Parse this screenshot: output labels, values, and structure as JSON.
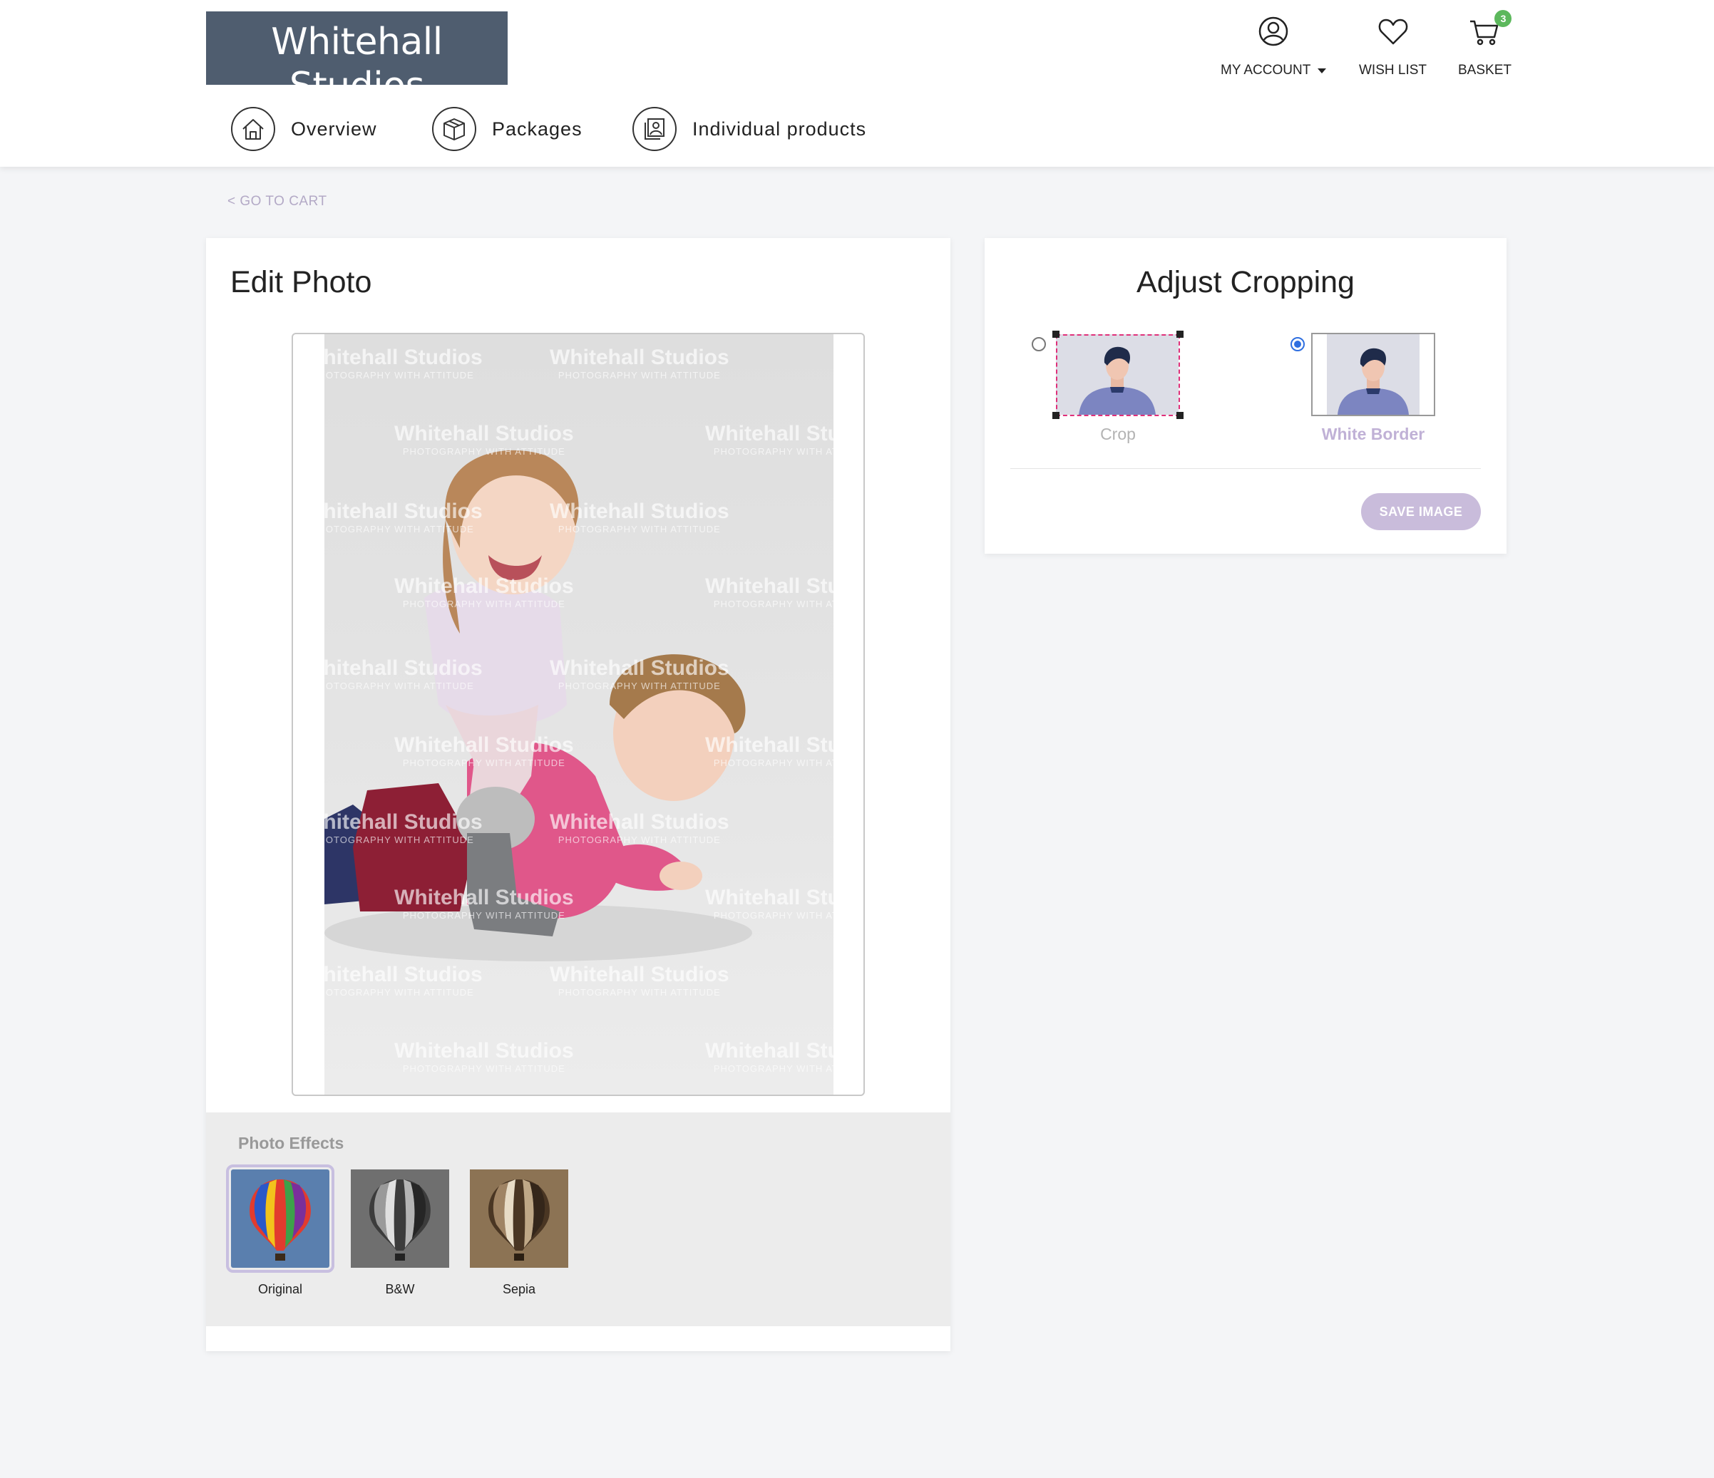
{
  "brand": {
    "name": "Whitehall Studios",
    "tagline": "PHOTOGRAPHY WITH ATTITUDE"
  },
  "header_nav": {
    "account": "MY ACCOUNT",
    "wishlist": "WISH LIST",
    "basket": "BASKET",
    "basket_count": "3"
  },
  "main_nav": [
    {
      "label": "Overview",
      "icon": "home-icon"
    },
    {
      "label": "Packages",
      "icon": "box-icon"
    },
    {
      "label": "Individual products",
      "icon": "photos-icon"
    }
  ],
  "back_link": "< GO TO CART",
  "edit_photo": {
    "title": "Edit Photo",
    "watermark_main": "Whitehall Studios",
    "watermark_sub": "PHOTOGRAPHY WITH ATTITUDE",
    "effects_title": "Photo Effects",
    "effects": [
      {
        "label": "Original",
        "selected": true
      },
      {
        "label": "B&W",
        "selected": false
      },
      {
        "label": "Sepia",
        "selected": false
      }
    ]
  },
  "cropping": {
    "title": "Adjust Cropping",
    "options": [
      {
        "label": "Crop",
        "selected": false,
        "label_color": "#b3b3b3"
      },
      {
        "label": "White Border",
        "selected": true,
        "label_color": "#c0b1d6"
      }
    ],
    "save_label": "SAVE IMAGE"
  },
  "colors": {
    "logo_bg": "#4f5d6f",
    "accent": "#c9bcdb",
    "badge": "#5cb85c",
    "radio_selected": "#2f6fe0",
    "crop_dash": "#e0307a"
  }
}
